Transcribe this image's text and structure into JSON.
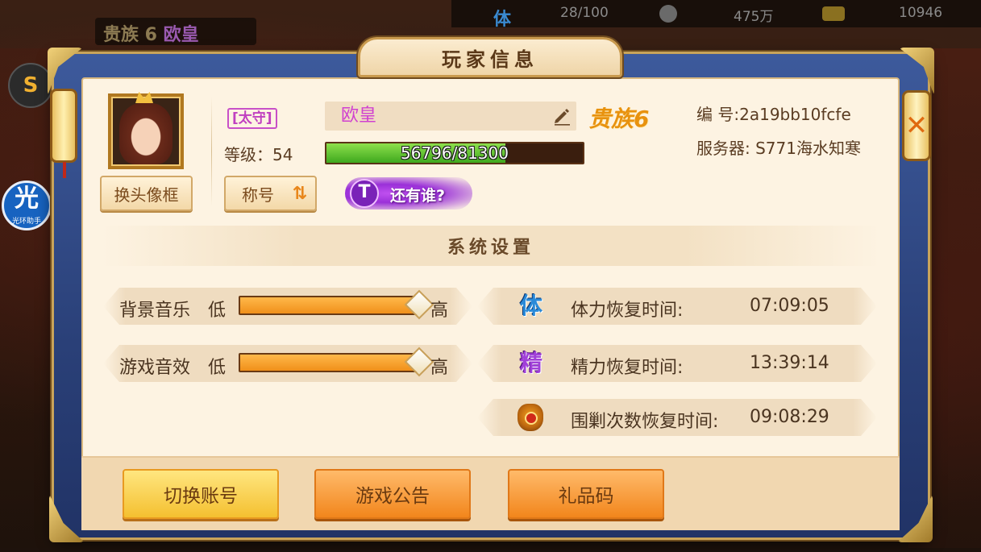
{
  "background": {
    "topbar": {
      "stamina_icon": "体",
      "stamina_value": "28/100",
      "coins_value": "475万",
      "gold_value": "10946"
    },
    "left_title": {
      "noble": "贵族 6",
      "name": "欧皇"
    },
    "assistant": {
      "icon_char": "光",
      "label": "光环助手"
    },
    "controller_icon": "S"
  },
  "dialog": {
    "title": "玩家信息",
    "close_icon": "✕"
  },
  "player": {
    "change_frame_label": "换头像框",
    "rank_badge": "[太守]",
    "name": "欧皇",
    "level_text": "等级：54",
    "exp": {
      "current": 56796,
      "max": 81300,
      "text": "56796/81300"
    },
    "noble_label": "贵族6",
    "title_button_label": "称号",
    "honor_badge": {
      "emblem": "T",
      "text": "还有谁?"
    },
    "id_key": "编 号:",
    "id_value": "2a19bb10fcfe",
    "server_key": "服务器:",
    "server_value": "S771海水知寒"
  },
  "settings": {
    "section_title": "系统设置",
    "music": {
      "label": "背景音乐",
      "low": "低",
      "high": "高",
      "level": 1.0
    },
    "sfx": {
      "label": "游戏音效",
      "low": "低",
      "high": "高",
      "level": 1.0
    },
    "stamina": {
      "icon": "体",
      "label": "体力恢复时间:",
      "time": "07:09:05"
    },
    "energy": {
      "icon": "精",
      "label": "精力恢复时间:",
      "time": "13:39:14"
    },
    "siege": {
      "label": "围剿次数恢复时间:",
      "time": "09:08:29"
    }
  },
  "actions": {
    "switch_account": "切换账号",
    "announcement": "游戏公告",
    "gift_code": "礼品码"
  },
  "colors": {
    "panel": "#fdf3e2",
    "frame": "#2a4078",
    "accent_orange": "#f0901a",
    "exp_green": "#3fa81e",
    "name_pink": "#d040d0",
    "noble_gold": "#e8920e"
  }
}
